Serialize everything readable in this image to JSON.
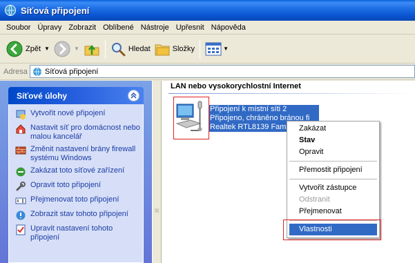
{
  "window": {
    "title": "Síťová připojení"
  },
  "menu": [
    "Soubor",
    "Úpravy",
    "Zobrazit",
    "Oblíbené",
    "Nástroje",
    "Upřesnit",
    "Nápověda"
  ],
  "toolbar": {
    "back_label": "Zpět",
    "search_label": "Hledat",
    "folders_label": "Složky"
  },
  "address": {
    "label": "Adresa",
    "value": "Síťová připojení"
  },
  "tasks": {
    "title": "Síťové úlohy",
    "items": [
      {
        "label": "Vytvořit nové připojení",
        "icon": "new-connection-icon"
      },
      {
        "label": "Nastavit síť pro domácnost nebo malou kancelář",
        "icon": "home-network-icon"
      },
      {
        "label": "Změnit nastavení brány firewall systému Windows",
        "icon": "firewall-icon"
      },
      {
        "label": "Zakázat toto síťové zařízení",
        "icon": "disable-device-icon"
      },
      {
        "label": "Opravit toto připojení",
        "icon": "repair-icon"
      },
      {
        "label": "Přejmenovat toto připojení",
        "icon": "rename-icon"
      },
      {
        "label": "Zobrazit stav tohoto připojení",
        "icon": "status-icon"
      },
      {
        "label": "Upravit nastavení tohoto připojení",
        "icon": "settings-icon"
      }
    ]
  },
  "main": {
    "section_title": "LAN nebo vysokorychlostní Internet",
    "connection": {
      "name": "Připojení k místní síti 2",
      "status": "Připojeno, chráněno bránou fi",
      "device": "Realtek RTL8139 Family"
    }
  },
  "context_menu": {
    "items": [
      {
        "label": "Zakázat"
      },
      {
        "label": "Stav"
      },
      {
        "label": "Opravit"
      },
      {
        "label": "Přemostit připojení"
      },
      {
        "label": "Vytvořit zástupce"
      },
      {
        "label": "Odstranit"
      },
      {
        "label": "Přejmenovat"
      },
      {
        "label": "Vlastnosti"
      }
    ]
  },
  "colors": {
    "title_bar": "#0a55d0",
    "task_pane": "#6375d6",
    "selection": "#316ac5",
    "highlight_box": "#e02020"
  }
}
